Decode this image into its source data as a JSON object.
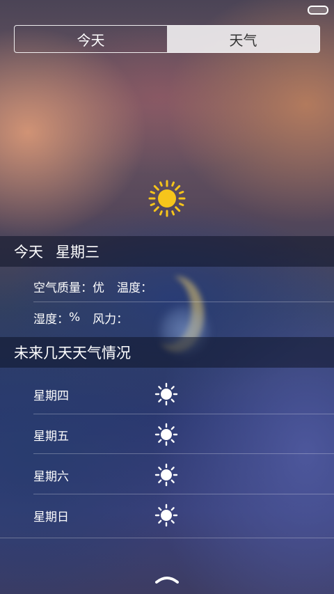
{
  "tabs": [
    {
      "label": "今天",
      "active": false
    },
    {
      "label": "天气",
      "active": true
    }
  ],
  "current": {
    "icon": "sun-icon",
    "icon_color": "#f6c51b",
    "header_day": "今天",
    "header_weekday": "星期三",
    "air_quality_label": "空气质量：",
    "air_quality_value": "优",
    "temperature_label": "温度：",
    "humidity_label": "湿度：",
    "humidity_value": "%",
    "wind_label": "风力："
  },
  "forecast": {
    "title": "未来几天天气情况",
    "days": [
      {
        "weekday": "星期四",
        "icon": "sun-icon"
      },
      {
        "weekday": "星期五",
        "icon": "sun-icon"
      },
      {
        "weekday": "星期六",
        "icon": "sun-icon"
      },
      {
        "weekday": "星期日",
        "icon": "sun-icon"
      }
    ]
  },
  "footer": {
    "pull_icon": "chevron-up-icon"
  }
}
